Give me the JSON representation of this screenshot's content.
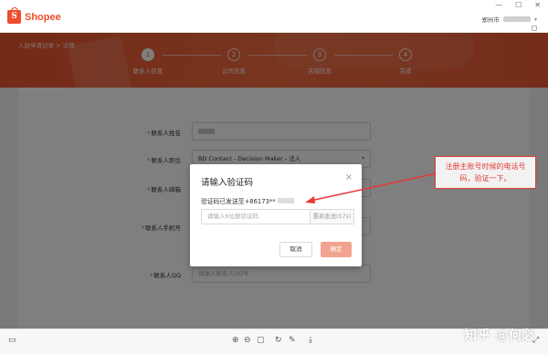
{
  "window": {
    "logo_text": "Shopee",
    "logo_mark": "S",
    "controls": [
      "—",
      "☐",
      "✕"
    ],
    "user_label": "郑州市"
  },
  "banner": {
    "breadcrumb": "入驻申请记录 > 详情",
    "steps": [
      {
        "num": "1",
        "label": "联系人信息",
        "active": true
      },
      {
        "num": "2",
        "label": "公司信息",
        "active": false
      },
      {
        "num": "3",
        "label": "店铺信息",
        "active": false
      },
      {
        "num": "4",
        "label": "完成",
        "active": false
      }
    ]
  },
  "form": {
    "name_label": "联系人姓名",
    "position_label": "联系人职位",
    "position_value": "BD Contact - Decision Maker - 法人",
    "email_label": "联系人邮箱",
    "phone_label": "联系人手机号",
    "qq_label": "联系人QQ",
    "qq_placeholder": "请输入联系人QQ号",
    "required_mark": "*"
  },
  "dialog": {
    "title": "请输入验证码",
    "close": "×",
    "sent_text": "验证码已发送至+86173**",
    "input_placeholder": "请输入6位数验证码",
    "resend_label": "重新发送(57s)",
    "cancel_label": "取消",
    "confirm_label": "确定"
  },
  "annotation": {
    "text": "注册主账号时候的电话号码，验证一下。",
    "color": "#e53935"
  },
  "bottom_bar": {
    "icons": [
      "screen-icon",
      "zoom-in-icon",
      "zoom-out-icon",
      "fit-icon",
      "rotate-icon",
      "edit-icon",
      "download-icon",
      "fullscreen-icon"
    ]
  },
  "watermark": "知乎 @何必",
  "colors": {
    "brand": "#ee4d2d",
    "confirm_disabled": "#f2a38f"
  }
}
